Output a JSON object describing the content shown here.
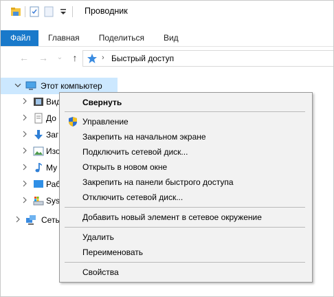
{
  "window": {
    "title": "Проводник"
  },
  "ribbon": {
    "tabs": [
      {
        "label": "Файл"
      },
      {
        "label": "Главная"
      },
      {
        "label": "Поделиться"
      },
      {
        "label": "Вид"
      }
    ]
  },
  "address": {
    "path": "Быстрый доступ",
    "back_glyph": "←",
    "forward_glyph": "→",
    "up_glyph": "↑",
    "history_glyph": "⌄"
  },
  "tree": {
    "items": [
      {
        "label": "Этот компьютер",
        "icon": "computer-icon",
        "expanded": true
      },
      {
        "label": "Вид",
        "icon": "videos-icon"
      },
      {
        "label": "До",
        "icon": "documents-icon"
      },
      {
        "label": "Заг",
        "icon": "downloads-icon"
      },
      {
        "label": "Изо",
        "icon": "pictures-icon"
      },
      {
        "label": "Му",
        "icon": "music-icon"
      },
      {
        "label": "Раб",
        "icon": "desktop-icon"
      },
      {
        "label": "Sys",
        "icon": "drive-icon"
      },
      {
        "label": "Сеть",
        "icon": "network-icon"
      }
    ]
  },
  "context_menu": {
    "items": [
      {
        "label": "Свернуть",
        "bold": true
      },
      {
        "label": "Управление",
        "icon": "shield-icon"
      },
      {
        "label": "Закрепить на начальном экране"
      },
      {
        "label": "Подключить сетевой диск..."
      },
      {
        "label": "Открыть в новом окне"
      },
      {
        "label": "Закрепить на панели быстрого доступа"
      },
      {
        "label": "Отключить сетевой диск..."
      },
      {
        "label": "Добавить новый элемент в сетевое окружение"
      },
      {
        "label": "Удалить"
      },
      {
        "label": "Переименовать"
      },
      {
        "label": "Свойства"
      }
    ]
  },
  "colors": {
    "file_tab": "#1979ca",
    "selection": "#cce8ff",
    "menu_bg": "#f2f2f2"
  }
}
